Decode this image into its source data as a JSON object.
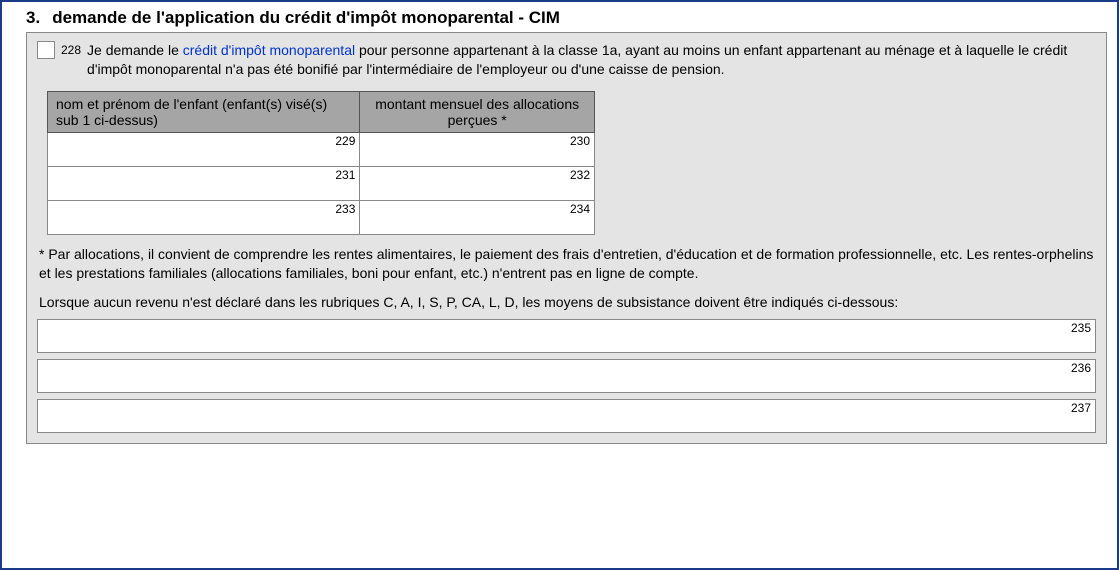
{
  "section": {
    "number": "3.",
    "title": "demande de l'application du crédit d'impôt monoparental - CIM"
  },
  "checkbox_code": "228",
  "request": {
    "pre": "Je demande le ",
    "link": "crédit d'impôt monoparental",
    "post": " pour personne appartenant à la classe 1a, ayant au moins un enfant appartenant au ménage et à laquelle le crédit d'impôt monoparental n'a pas été bonifié par l'intermédiaire de l'employeur ou d'une caisse de pension."
  },
  "table": {
    "header_name": "nom et prénom de l'enfant (enfant(s) visé(s) sub 1 ci-dessus)",
    "header_amount": "montant mensuel des allocations perçues *",
    "rows": [
      {
        "name_code": "229",
        "amount_code": "230"
      },
      {
        "name_code": "231",
        "amount_code": "232"
      },
      {
        "name_code": "233",
        "amount_code": "234"
      }
    ]
  },
  "footnote": "* Par allocations, il convient de comprendre les rentes alimentaires, le paiement des frais d'entretien, d'éducation et de formation professionnelle, etc. Les rentes-orphelins et les prestations familiales (allocations familiales, boni pour enfant, etc.) n'entrent pas en ligne de compte.",
  "subsistence_note": "Lorsque aucun revenu n'est déclaré dans les rubriques C, A, I, S, P, CA, L, D, les moyens de subsistance doivent être indiqués ci-dessous:",
  "long_fields": [
    {
      "code": "235"
    },
    {
      "code": "236"
    },
    {
      "code": "237"
    }
  ]
}
